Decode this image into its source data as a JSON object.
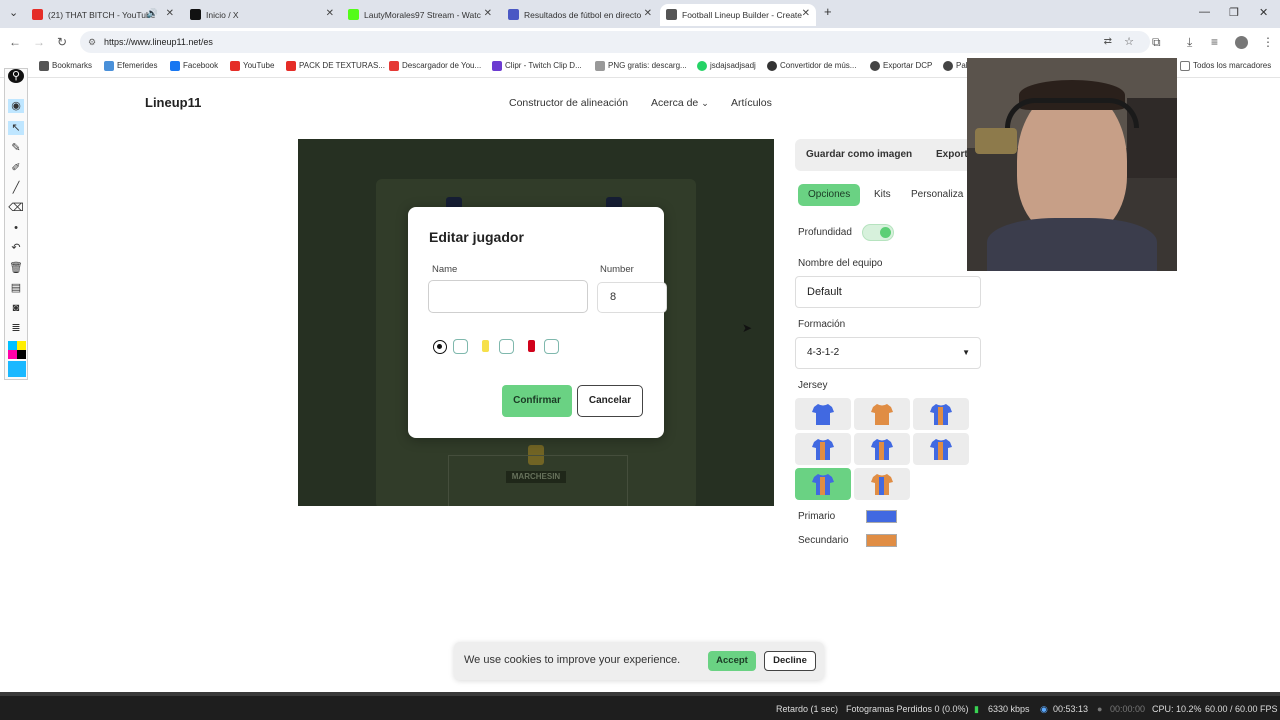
{
  "browser": {
    "tabs": [
      {
        "label": "(21) THAT BITCH - YouTube",
        "color": "#e52d27"
      },
      {
        "label": "Inicio / X",
        "color": "#111111"
      },
      {
        "label": "LautyMorales97 Stream - Watc",
        "color": "#53fc18"
      },
      {
        "label": "Resultados de fútbol en directo",
        "color": "#4a58c4"
      },
      {
        "label": "Football Lineup Builder - Create",
        "color": "#555555"
      }
    ],
    "url": "https://www.lineup11.net/es",
    "bookmarks": [
      {
        "label": "Bookmarks",
        "color": "#555555"
      },
      {
        "label": "Efemerides",
        "color": "#4a90d9"
      },
      {
        "label": "Facebook",
        "color": "#1877f2"
      },
      {
        "label": "YouTube",
        "color": "#e52d27"
      },
      {
        "label": "PACK DE TEXTURAS...",
        "color": "#e52d27"
      },
      {
        "label": "Descargador de You...",
        "color": "#e53935"
      },
      {
        "label": "Clipr - Twitch Clip D...",
        "color": "#6c3bd1"
      },
      {
        "label": "PNG gratis: descarg...",
        "color": "#999999"
      },
      {
        "label": "jsdajsadjsadj",
        "color": "#25d366"
      },
      {
        "label": "Convertidor de mús...",
        "color": "#333333"
      },
      {
        "label": "Exportar DCP",
        "color": "#444444"
      },
      {
        "label": "Pal",
        "color": "#444444"
      },
      {
        "label": "Todos los marcadores",
        "color": "#777777"
      }
    ]
  },
  "site": {
    "logo": "Lineup11",
    "nav": [
      "Constructor de alineación",
      "Acerca de",
      "Artículos"
    ]
  },
  "pitch": {
    "keeper_name": "MARCHESIN"
  },
  "modal": {
    "title": "Editar jugador",
    "name_label": "Name",
    "name_value": "",
    "number_label": "Number",
    "number_value": "8",
    "confirm": "Confirmar",
    "cancel": "Cancelar",
    "colors": [
      "#ffffff",
      "#f6e04a",
      "#d0021b"
    ]
  },
  "panel": {
    "save_image": "Guardar como imagen",
    "export": "Exporta",
    "tabs": [
      "Opciones",
      "Kits",
      "Personaliza"
    ],
    "depth_label": "Profundidad",
    "team_name_label": "Nombre del equipo",
    "team_name_value": "Default",
    "formation_label": "Formación",
    "formation_value": "4-3-1-2",
    "jersey_label": "Jersey",
    "primary_label": "Primario",
    "primary_color": "#4169e1",
    "secondary_label": "Secundario",
    "secondary_color": "#e08d44"
  },
  "cookie": {
    "text": "We use cookies to improve your experience.",
    "accept": "Accept",
    "decline": "Decline"
  },
  "obs": {
    "delay": "Retardo (1 sec)",
    "dropped": "Fotogramas Perdidos 0 (0.0%)",
    "bitrate": "6330 kbps",
    "stream_time": "00:53:13",
    "rec_time": "00:00:00",
    "cpu": "CPU: 10.2%",
    "fps": "60.00 / 60.00 FPS"
  }
}
